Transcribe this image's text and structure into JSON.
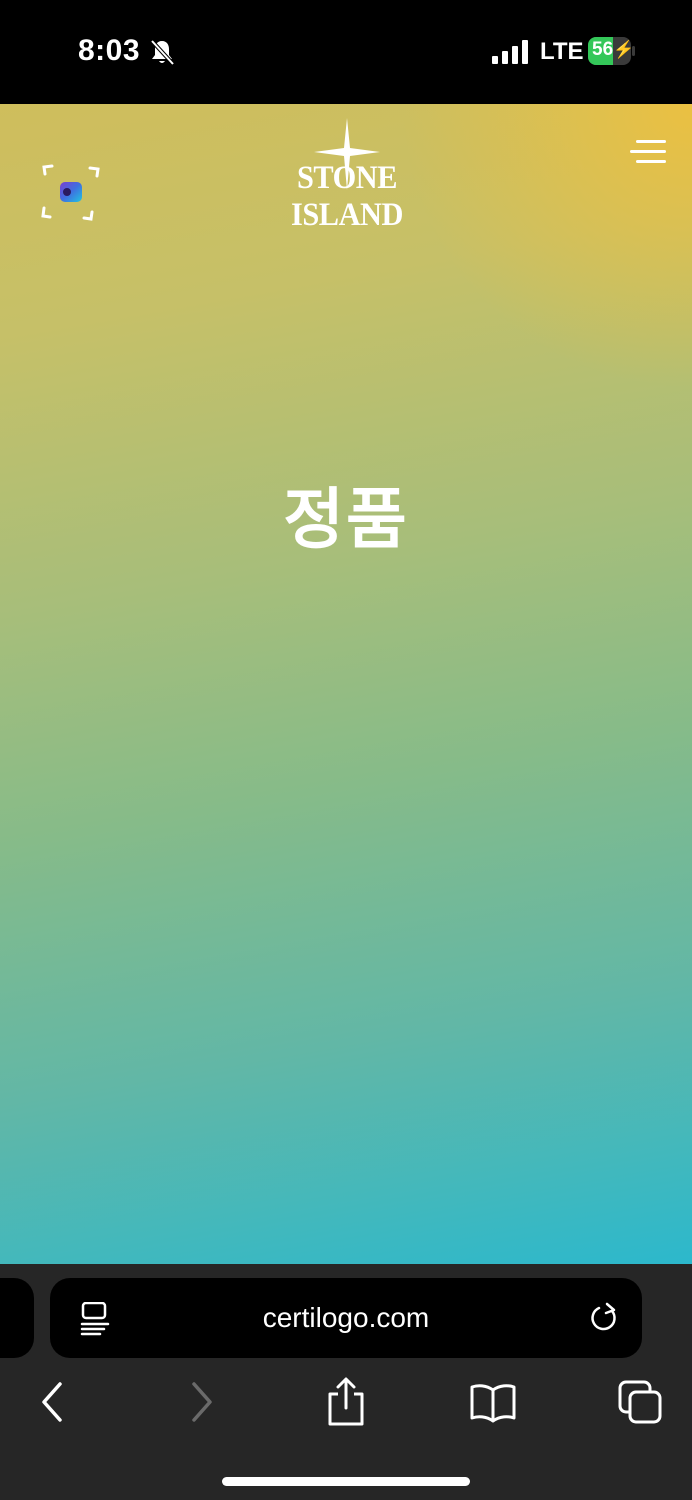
{
  "status_bar": {
    "time": "8:03",
    "network": "LTE",
    "battery": "56"
  },
  "page": {
    "brand": "STONE ISLAND",
    "headline": "정품"
  },
  "browser": {
    "url": "certilogo.com"
  },
  "icons": [
    "bell-slash-icon",
    "signal-icon",
    "battery-icon",
    "scan-icon",
    "menu-icon",
    "reader-icon",
    "reload-icon",
    "back-icon",
    "forward-icon",
    "share-icon",
    "bookmarks-icon",
    "tabs-icon"
  ],
  "colors": {
    "gradient_top": "#cfbe5c",
    "gradient_mid": "#86bb89",
    "gradient_bottom": "#2cb8cc",
    "battery_green": "#34c759",
    "toolbar": "#262626"
  }
}
